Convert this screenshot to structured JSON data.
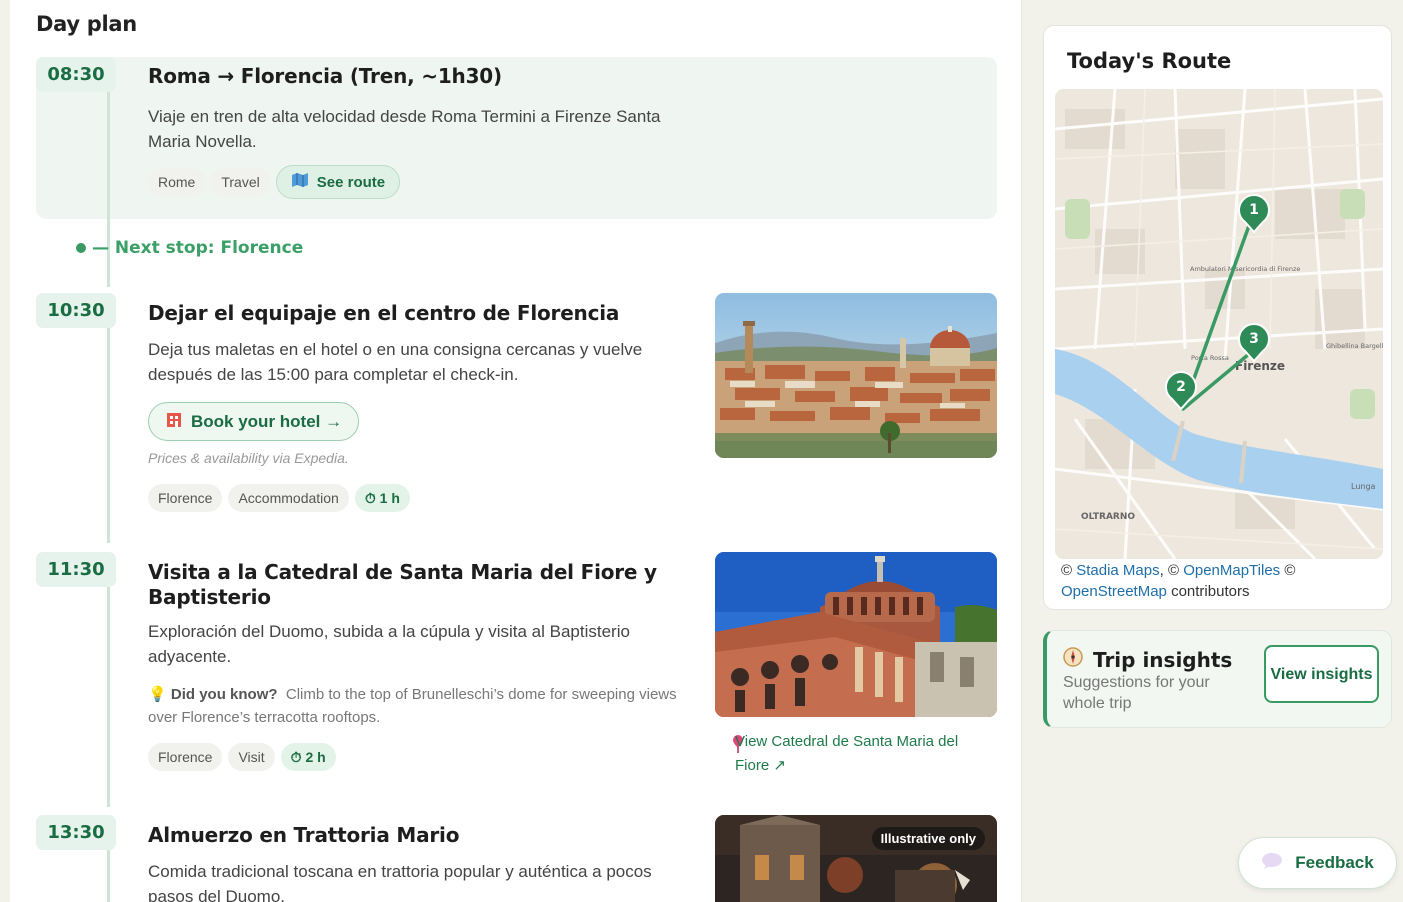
{
  "day_plan": {
    "title": "Day plan"
  },
  "entries": [
    {
      "time": "08:30",
      "title": "Roma → Florencia (Tren, ~1h30)",
      "desc": "Viaje en tren de alta velocidad desde Roma Termini a Firenze Santa Maria Novella.",
      "tags": [
        "Rome",
        "Travel"
      ],
      "route_button": "See route"
    },
    {
      "time": "10:30",
      "title": "Dejar el equipaje en el centro de Florencia",
      "desc": "Deja tus maletas en el hotel o en una consigna cercanas y vuelve después de las 15:00 para completar el check-in.",
      "book_button": "Book your hotel →",
      "book_note": "Prices & availability via Expedia.",
      "tags": [
        "Florence",
        "Accommodation"
      ],
      "duration": "⏱ 1 h"
    },
    {
      "time": "11:30",
      "title": "Visita a la Catedral de Santa Maria del Fiore y Baptisterio",
      "desc": "Exploración del Duomo, subida a la cúpula y visita al Baptisterio adyacente.",
      "did_you_know_label": "Did you know?",
      "did_you_know_text": "Climb to the top of Brunelleschi’s dome for sweeping views over Florence’s terracotta rooftops.",
      "tags": [
        "Florence",
        "Visit"
      ],
      "duration": "⏱ 2 h",
      "view_link": "View Catedral de Santa Maria del Fiore ↗"
    },
    {
      "time": "13:30",
      "title": "Almuerzo en Trattoria Mario",
      "desc": "Comida tradicional toscana en trattoria popular y auténtica a pocos pasos del Duomo.",
      "photo_badge": "Illustrative only"
    }
  ],
  "next_stop": "— Next stop: Florence",
  "sidebar": {
    "route_title": "Today's Route",
    "map": {
      "markers": [
        "1",
        "2",
        "3"
      ],
      "labels": {
        "city": "Firenze",
        "oltrarno": "OLTRARNO",
        "hospital": "Ambulatori Misericordia di Firenze",
        "porta_rossa": "Porta Rossa",
        "ghibellina": "Ghibellina Bargello",
        "lungarno": "Lunga"
      }
    },
    "attribution": {
      "c1": "©",
      "stadia": "Stadia Maps",
      "c2": ", ©",
      "openmaptiles": "OpenMapTiles",
      "c3": "©",
      "osm": "OpenStreetMap",
      "contributors": "contributors"
    },
    "insights": {
      "title": "Trip insights",
      "subtitle": "Suggestions for your whole trip",
      "button": "View insights"
    },
    "feedback": "Feedback"
  },
  "colors": {
    "accent": "#1a6c42",
    "accent_light": "#e6f3ec",
    "marker": "#2e8b57",
    "river": "#a9d0ee"
  }
}
